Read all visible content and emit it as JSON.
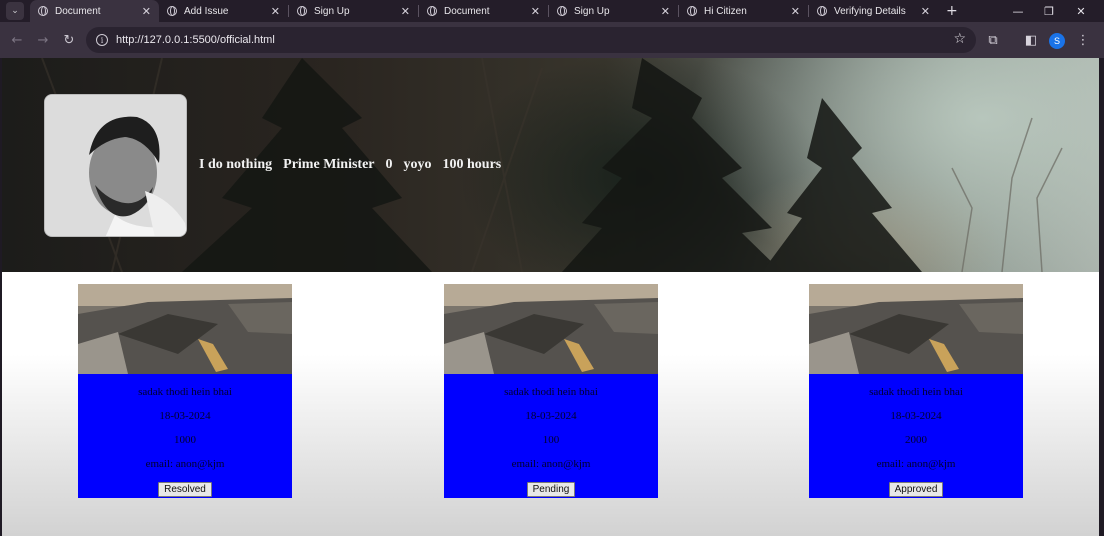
{
  "browser": {
    "tabs": [
      {
        "title": "Document",
        "active": true
      },
      {
        "title": "Add Issue",
        "active": false
      },
      {
        "title": "Sign Up",
        "active": false
      },
      {
        "title": "Document",
        "active": false
      },
      {
        "title": "Sign Up",
        "active": false
      },
      {
        "title": "Hi Citizen",
        "active": false
      },
      {
        "title": "Verifying Details",
        "active": false
      }
    ],
    "url": "http://127.0.0.1:5500/official.html",
    "profile_initial": "S"
  },
  "profile": {
    "details": [
      "I do nothing",
      "Prime Minister",
      "0",
      "yoyo",
      "100 hours"
    ]
  },
  "issues": [
    {
      "title": "sadak thodi hein bhai",
      "date": "18-03-2024",
      "amount": "1000",
      "email": "email: anon@kjm",
      "status": "Resolved"
    },
    {
      "title": "sadak thodi hein bhai",
      "date": "18-03-2024",
      "amount": "100",
      "email": "email: anon@kjm",
      "status": "Pending"
    },
    {
      "title": "sadak thodi hein bhai",
      "date": "18-03-2024",
      "amount": "2000",
      "email": "email: anon@kjm",
      "status": "Approved"
    }
  ],
  "colors": {
    "card_body": "#0000ff",
    "chrome_bg": "#241d29",
    "toolbar_bg": "#3a3240"
  }
}
